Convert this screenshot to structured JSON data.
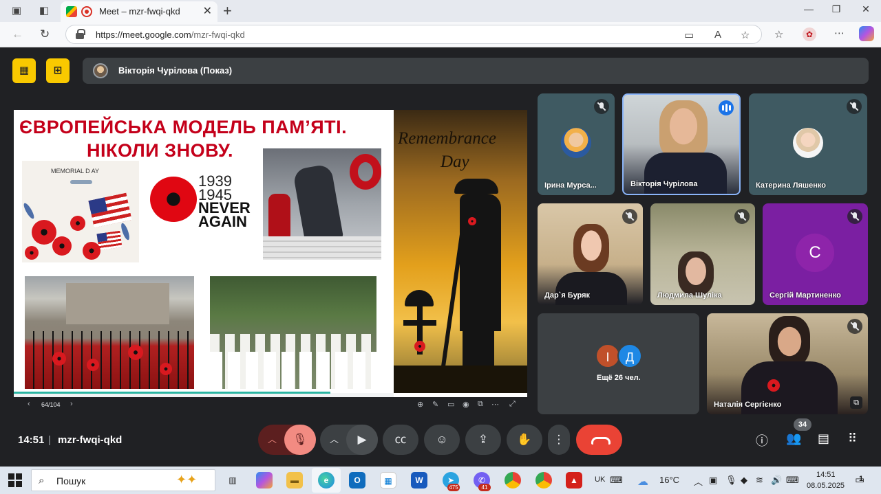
{
  "browser": {
    "tab_title": "Meet – mzr-fwqi-qkd",
    "url_host": "https://meet.google.com",
    "url_path": "/mzr-fwqi-qkd"
  },
  "meet": {
    "presenter_label": "Вікторія Чурілова (Показ)",
    "slide": {
      "title_line1": "ЄВРОПЕЙСЬКА МОДЕЛЬ ПАМ’ЯТІ.",
      "title_line2": "НІКОЛИ ЗНОВУ.",
      "memorial_text": "MEMORIAL D AY",
      "years_1": "1939",
      "years_2": "1945",
      "never": "NEVER",
      "again": "AGAIN",
      "remembrance_1": "Remembrance",
      "remembrance_2": "Day",
      "page": "64/104"
    },
    "participants": [
      {
        "name": "Ірина Мурса...",
        "status": "muted"
      },
      {
        "name": "Вікторія Чурілова",
        "status": "speaking"
      },
      {
        "name": "Катерина Ляшенко",
        "status": "muted"
      },
      {
        "name": "Дар`я Буряк",
        "status": "muted"
      },
      {
        "name": "Людмила Шуліка",
        "status": "muted"
      },
      {
        "name": "Сергій Мартиненко",
        "status": "muted",
        "initial": "С"
      },
      {
        "name": "Наталія Сергієнко",
        "status": "muted"
      }
    ],
    "others": {
      "initials": [
        "І",
        "Д"
      ],
      "label": "Ещё 26 чел."
    },
    "bottom": {
      "time": "14:51",
      "meeting_code": "mzr-fwqi-qkd",
      "people_count": "34"
    },
    "colors": {
      "hangup": "#ea4335",
      "mic_off": "#f28b82",
      "accent_yellow": "#f9c900"
    }
  },
  "taskbar": {
    "search_placeholder": "Пошук",
    "lang": "UK",
    "temperature": "16°C",
    "clock_time": "14:51",
    "clock_date": "08.05.2025",
    "badge_telegram": "475",
    "badge_viber": "41",
    "notif_count": "1"
  }
}
